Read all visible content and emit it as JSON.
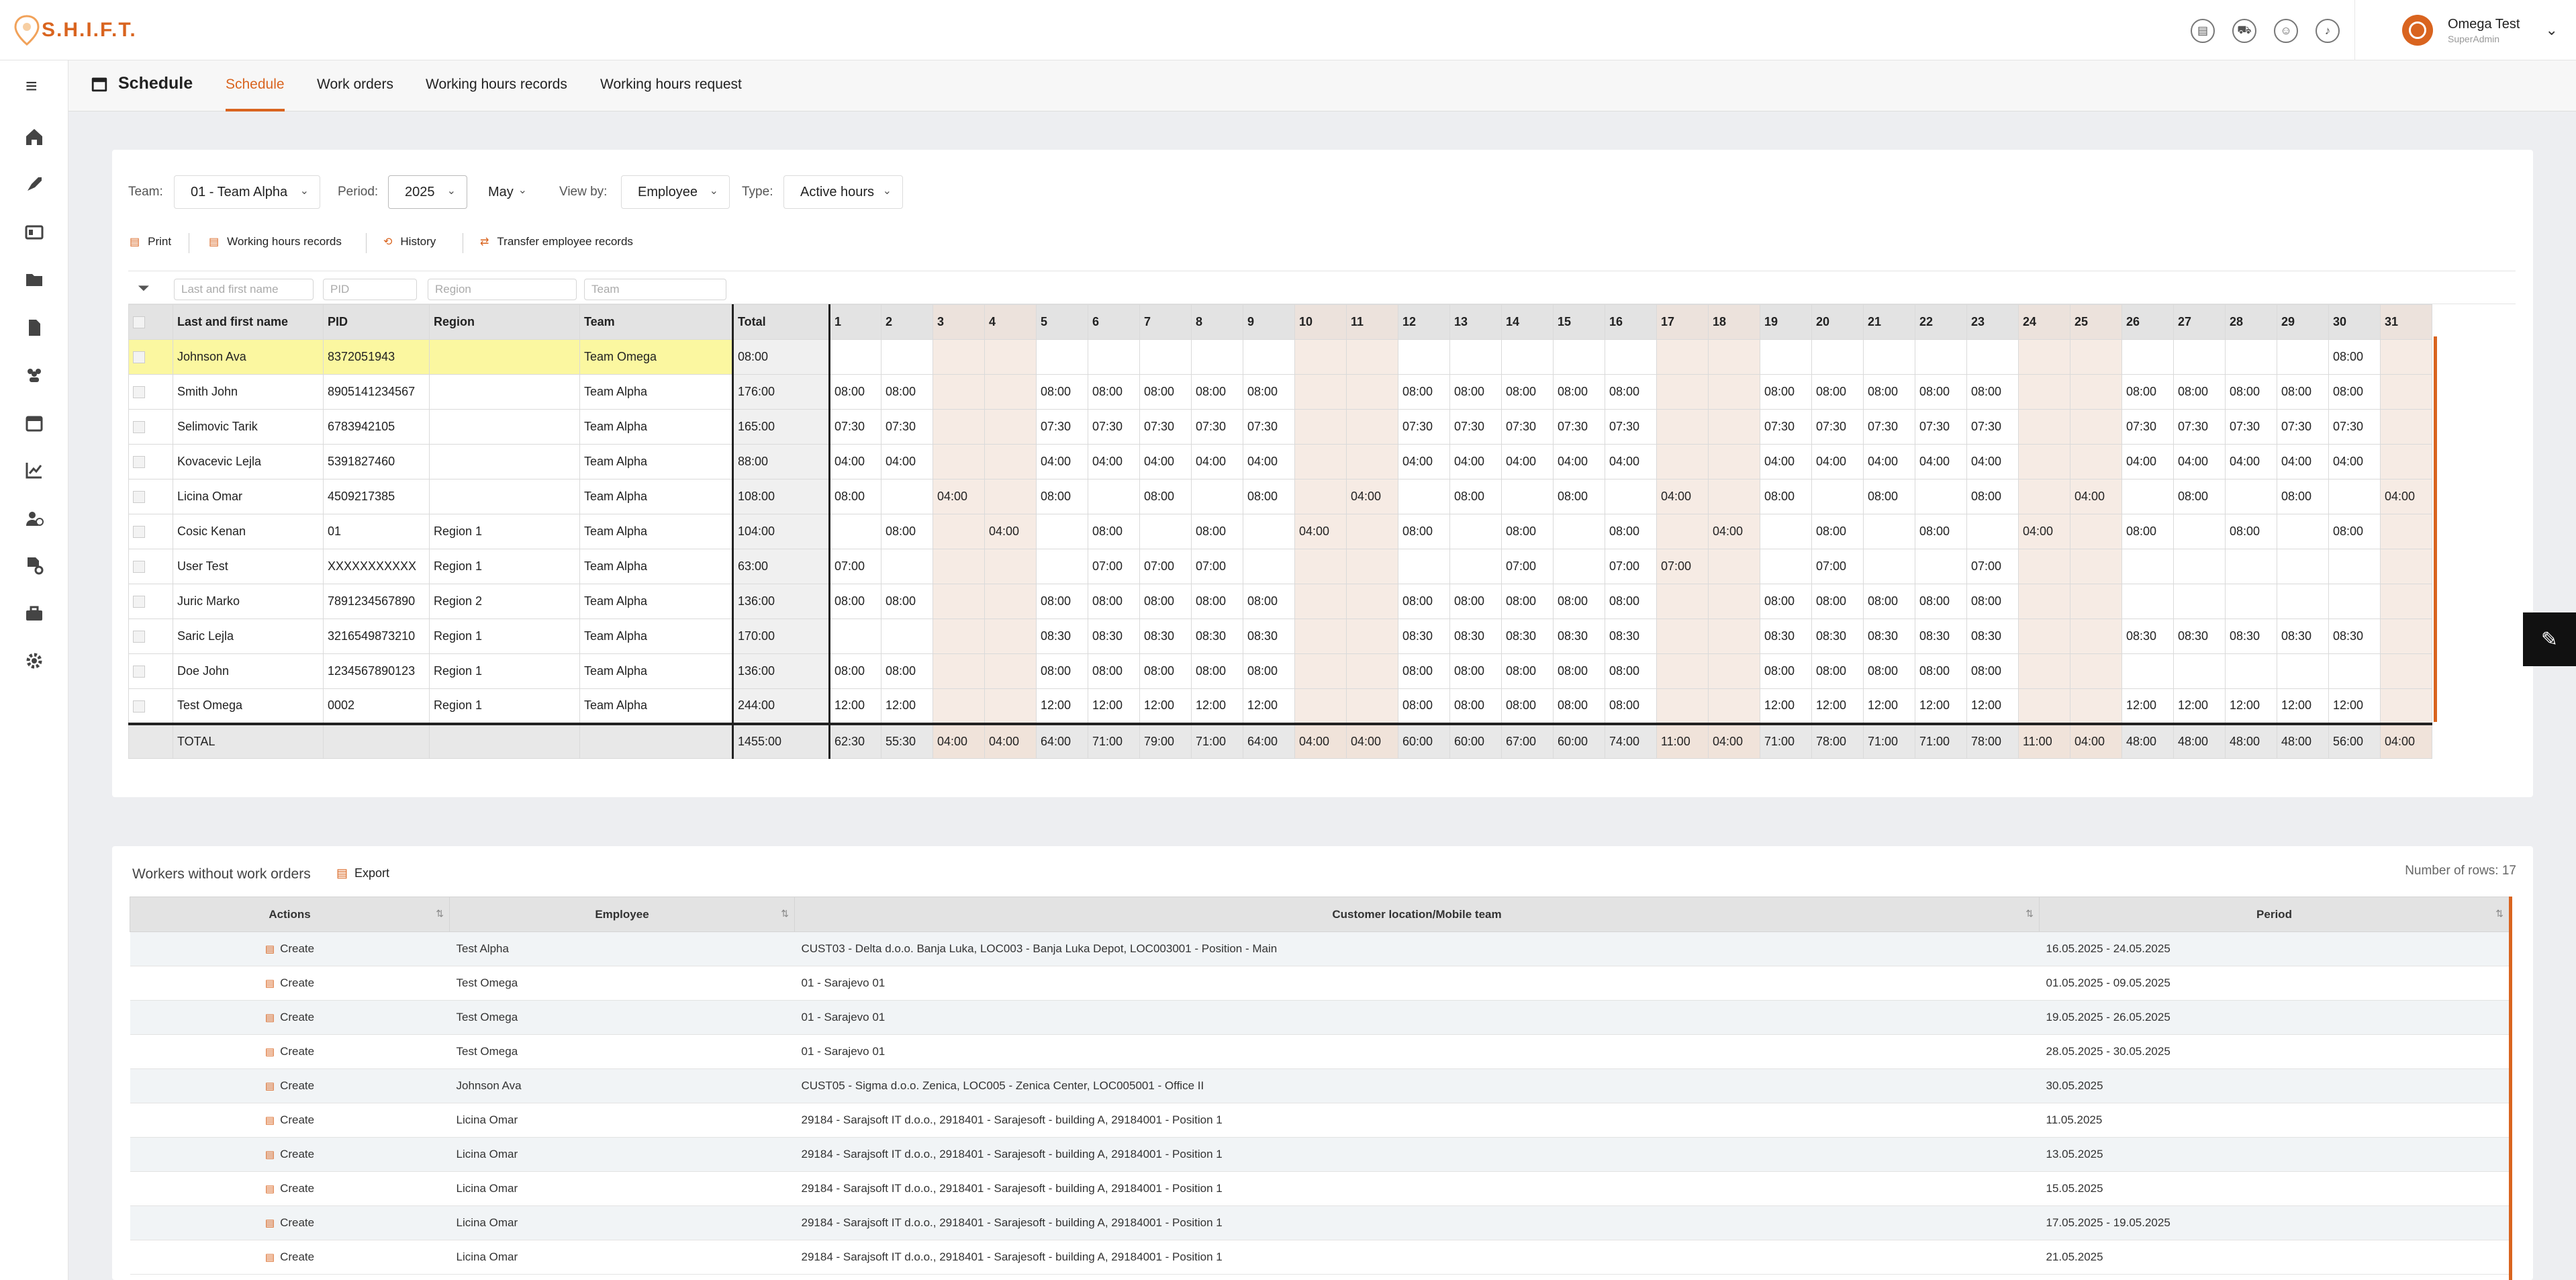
{
  "app": {
    "logo": "S.H.I.F.T.",
    "user_name": "Omega Test",
    "user_role": "SuperAdmin"
  },
  "topbar_icons": [
    "document-clock-icon",
    "car-icon",
    "user-settings-icon",
    "bell-icon"
  ],
  "nav": {
    "page_title": "Schedule",
    "tabs": [
      "Schedule",
      "Work orders",
      "Working hours records",
      "Working hours request"
    ],
    "active_tab": "Schedule"
  },
  "sidebar_icons": [
    "home-icon",
    "rocket-icon",
    "id-card-icon",
    "folder-gear-icon",
    "document-icon",
    "team-icon",
    "calendar-icon",
    "chart-icon",
    "user-clock-icon",
    "document-settings-icon",
    "toolbox-icon",
    "gear-icon"
  ],
  "filters": {
    "team_label": "Team:",
    "team_value": "01 - Team Alpha",
    "period_label": "Period:",
    "year_value": "2025",
    "month_value": "May",
    "viewby_label": "View by:",
    "viewby_value": "Employee",
    "type_label": "Type:",
    "type_value": "Active hours"
  },
  "actions": {
    "print": "Print",
    "whr": "Working hours records",
    "history": "History",
    "transfer": "Transfer employee records"
  },
  "grid_filters": {
    "name": "Last and first name",
    "pid": "PID",
    "region": "Region",
    "team": "Team"
  },
  "grid": {
    "headers": {
      "name": "Last and first name",
      "pid": "PID",
      "region": "Region",
      "team": "Team",
      "total": "Total"
    },
    "days": [
      "1",
      "2",
      "3",
      "4",
      "5",
      "6",
      "7",
      "8",
      "9",
      "10",
      "11",
      "12",
      "13",
      "14",
      "15",
      "16",
      "17",
      "18",
      "19",
      "20",
      "21",
      "22",
      "23",
      "24",
      "25",
      "26",
      "27",
      "28",
      "29",
      "30",
      "31"
    ],
    "weekend_days": [
      3,
      4,
      10,
      11,
      17,
      18,
      24,
      25,
      31
    ],
    "rows": [
      {
        "name": "Johnson Ava",
        "pid": "8372051943",
        "region": "",
        "team": "Team Omega",
        "total": "08:00",
        "highlight": true,
        "hours": [
          "",
          "",
          "",
          "",
          "",
          "",
          "",
          "",
          "",
          "",
          "",
          "",
          "",
          "",
          "",
          "",
          "",
          "",
          "",
          "",
          "",
          "",
          "",
          "",
          "",
          "",
          "",
          "",
          "",
          "08:00",
          ""
        ]
      },
      {
        "name": "Smith John",
        "pid": "8905141234567",
        "region": "",
        "team": "Team Alpha",
        "total": "176:00",
        "hours": [
          "08:00",
          "08:00",
          "",
          "",
          "08:00",
          "08:00",
          "08:00",
          "08:00",
          "08:00",
          "",
          "",
          "08:00",
          "08:00",
          "08:00",
          "08:00",
          "08:00",
          "",
          "",
          "08:00",
          "08:00",
          "08:00",
          "08:00",
          "08:00",
          "",
          "",
          "08:00",
          "08:00",
          "08:00",
          "08:00",
          "08:00",
          ""
        ]
      },
      {
        "name": "Selimovic Tarik",
        "pid": "6783942105",
        "region": "",
        "team": "Team Alpha",
        "total": "165:00",
        "hours": [
          "07:30",
          "07:30",
          "",
          "",
          "07:30",
          "07:30",
          "07:30",
          "07:30",
          "07:30",
          "",
          "",
          "07:30",
          "07:30",
          "07:30",
          "07:30",
          "07:30",
          "",
          "",
          "07:30",
          "07:30",
          "07:30",
          "07:30",
          "07:30",
          "",
          "",
          "07:30",
          "07:30",
          "07:30",
          "07:30",
          "07:30",
          ""
        ]
      },
      {
        "name": "Kovacevic Lejla",
        "pid": "5391827460",
        "region": "",
        "team": "Team Alpha",
        "total": "88:00",
        "hours": [
          "04:00",
          "04:00",
          "",
          "",
          "04:00",
          "04:00",
          "04:00",
          "04:00",
          "04:00",
          "",
          "",
          "04:00",
          "04:00",
          "04:00",
          "04:00",
          "04:00",
          "",
          "",
          "04:00",
          "04:00",
          "04:00",
          "04:00",
          "04:00",
          "",
          "",
          "04:00",
          "04:00",
          "04:00",
          "04:00",
          "04:00",
          ""
        ]
      },
      {
        "name": "Licina Omar",
        "pid": "4509217385",
        "region": "",
        "team": "Team Alpha",
        "total": "108:00",
        "hours": [
          "08:00",
          "",
          "04:00",
          "",
          "08:00",
          "",
          "08:00",
          "",
          "08:00",
          "",
          "04:00",
          "",
          "08:00",
          "",
          "08:00",
          "",
          "04:00",
          "",
          "08:00",
          "",
          "08:00",
          "",
          "08:00",
          "",
          "04:00",
          "",
          "08:00",
          "",
          "08:00",
          "",
          "04:00"
        ]
      },
      {
        "name": "Cosic Kenan",
        "pid": "01",
        "region": "Region 1",
        "team": "Team Alpha",
        "total": "104:00",
        "hours": [
          "",
          "08:00",
          "",
          "04:00",
          "",
          "08:00",
          "",
          "08:00",
          "",
          "04:00",
          "",
          "08:00",
          "",
          "08:00",
          "",
          "08:00",
          "",
          "04:00",
          "",
          "08:00",
          "",
          "08:00",
          "",
          "04:00",
          "",
          "08:00",
          "",
          "08:00",
          "",
          "08:00",
          ""
        ]
      },
      {
        "name": "User Test",
        "pid": "XXXXXXXXXXX",
        "region": "Region 1",
        "team": "Team Alpha",
        "total": "63:00",
        "hours": [
          "07:00",
          "",
          "",
          "",
          "",
          "07:00",
          "07:00",
          "07:00",
          "",
          "",
          "",
          "",
          "",
          "07:00",
          "",
          "07:00",
          "07:00",
          "",
          "",
          "07:00",
          "",
          "",
          "07:00",
          "",
          "",
          "",
          "",
          "",
          "",
          "",
          ""
        ]
      },
      {
        "name": "Juric Marko",
        "pid": "7891234567890",
        "region": "Region 2",
        "team": "Team Alpha",
        "total": "136:00",
        "hours": [
          "08:00",
          "08:00",
          "",
          "",
          "08:00",
          "08:00",
          "08:00",
          "08:00",
          "08:00",
          "",
          "",
          "08:00",
          "08:00",
          "08:00",
          "08:00",
          "08:00",
          "",
          "",
          "08:00",
          "08:00",
          "08:00",
          "08:00",
          "08:00",
          "",
          "",
          "",
          "",
          "",
          "",
          "",
          ""
        ]
      },
      {
        "name": "Saric Lejla",
        "pid": "3216549873210",
        "region": "Region 1",
        "team": "Team Alpha",
        "total": "170:00",
        "hours": [
          "",
          "",
          "",
          "",
          "08:30",
          "08:30",
          "08:30",
          "08:30",
          "08:30",
          "",
          "",
          "08:30",
          "08:30",
          "08:30",
          "08:30",
          "08:30",
          "",
          "",
          "08:30",
          "08:30",
          "08:30",
          "08:30",
          "08:30",
          "",
          "",
          "08:30",
          "08:30",
          "08:30",
          "08:30",
          "08:30",
          ""
        ]
      },
      {
        "name": "Doe John",
        "pid": "1234567890123",
        "region": "Region 1",
        "team": "Team Alpha",
        "total": "136:00",
        "hours": [
          "08:00",
          "08:00",
          "",
          "",
          "08:00",
          "08:00",
          "08:00",
          "08:00",
          "08:00",
          "",
          "",
          "08:00",
          "08:00",
          "08:00",
          "08:00",
          "08:00",
          "",
          "",
          "08:00",
          "08:00",
          "08:00",
          "08:00",
          "08:00",
          "",
          "",
          "",
          "",
          "",
          "",
          "",
          ""
        ]
      },
      {
        "name": "Test Omega",
        "pid": "0002",
        "region": "Region 1",
        "team": "Team Alpha",
        "total": "244:00",
        "hours": [
          "12:00",
          "12:00",
          "",
          "",
          "12:00",
          "12:00",
          "12:00",
          "12:00",
          "12:00",
          "",
          "",
          "08:00",
          "08:00",
          "08:00",
          "08:00",
          "08:00",
          "",
          "",
          "12:00",
          "12:00",
          "12:00",
          "12:00",
          "12:00",
          "",
          "",
          "12:00",
          "12:00",
          "12:00",
          "12:00",
          "12:00",
          ""
        ]
      }
    ],
    "totals": {
      "label": "TOTAL",
      "total": "1455:00",
      "days": [
        "62:30",
        "55:30",
        "04:00",
        "04:00",
        "64:00",
        "71:00",
        "79:00",
        "71:00",
        "64:00",
        "04:00",
        "04:00",
        "60:00",
        "60:00",
        "67:00",
        "60:00",
        "74:00",
        "11:00",
        "04:00",
        "71:00",
        "78:00",
        "71:00",
        "71:00",
        "78:00",
        "11:00",
        "04:00",
        "48:00",
        "48:00",
        "48:00",
        "48:00",
        "56:00",
        "04:00"
      ]
    }
  },
  "workers": {
    "title": "Workers without work orders",
    "export": "Export",
    "count": "Number of rows: 17",
    "headers": {
      "actions": "Actions",
      "employee": "Employee",
      "location": "Customer location/Mobile team",
      "period": "Period"
    },
    "action_label": "Create",
    "rows": [
      {
        "employee": "Test Alpha",
        "location": "CUST03 - Delta d.o.o. Banja Luka, LOC003 - Banja Luka Depot, LOC003001 - Position - Main",
        "period": "16.05.2025 - 24.05.2025"
      },
      {
        "employee": "Test Omega",
        "location": "01 - Sarajevo 01",
        "period": "01.05.2025 - 09.05.2025"
      },
      {
        "employee": "Test Omega",
        "location": "01 - Sarajevo 01",
        "period": "19.05.2025 - 26.05.2025"
      },
      {
        "employee": "Test Omega",
        "location": "01 - Sarajevo 01",
        "period": "28.05.2025 - 30.05.2025"
      },
      {
        "employee": "Johnson Ava",
        "location": "CUST05 - Sigma d.o.o. Zenica, LOC005 - Zenica Center, LOC005001 - Office II",
        "period": "30.05.2025"
      },
      {
        "employee": "Licina Omar",
        "location": "29184 - Sarajsoft IT d.o.o., 2918401 - Sarajesoft - building A, 29184001 - Position 1",
        "period": "11.05.2025"
      },
      {
        "employee": "Licina Omar",
        "location": "29184 - Sarajsoft IT d.o.o., 2918401 - Sarajesoft - building A, 29184001 - Position 1",
        "period": "13.05.2025"
      },
      {
        "employee": "Licina Omar",
        "location": "29184 - Sarajsoft IT d.o.o., 2918401 - Sarajesoft - building A, 29184001 - Position 1",
        "period": "15.05.2025"
      },
      {
        "employee": "Licina Omar",
        "location": "29184 - Sarajsoft IT d.o.o., 2918401 - Sarajesoft - building A, 29184001 - Position 1",
        "period": "17.05.2025 - 19.05.2025"
      },
      {
        "employee": "Licina Omar",
        "location": "29184 - Sarajsoft IT d.o.o., 2918401 - Sarajesoft - building A, 29184001 - Position 1",
        "period": "21.05.2025"
      }
    ]
  },
  "colors": {
    "accent": "#d9641f",
    "highlight": "#fbf7a0",
    "weekend": "#f6ebe4"
  }
}
